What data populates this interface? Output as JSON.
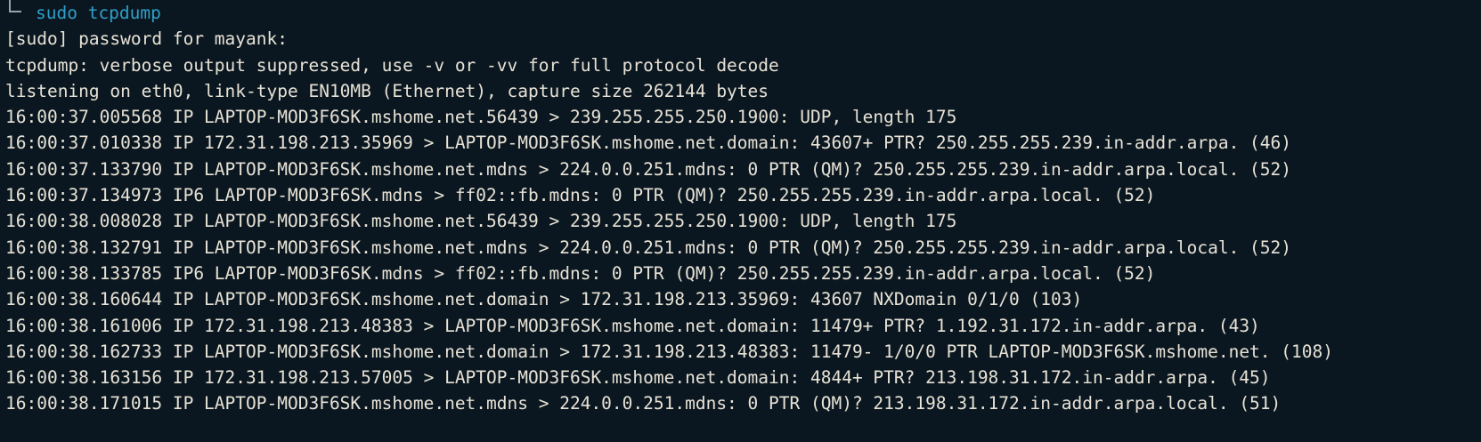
{
  "colors": {
    "background": "#0b1720",
    "text": "#e7e2d6",
    "command": "#2e9fc9",
    "prompt_branch": "#9aa3a8"
  },
  "prompt": {
    "branch_icon": "tree-branch-corner",
    "command": "sudo tcpdump"
  },
  "output": [
    "[sudo] password for mayank:",
    "tcpdump: verbose output suppressed, use -v or -vv for full protocol decode",
    "listening on eth0, link-type EN10MB (Ethernet), capture size 262144 bytes",
    "16:00:37.005568 IP LAPTOP-MOD3F6SK.mshome.net.56439 > 239.255.255.250.1900: UDP, length 175",
    "16:00:37.010338 IP 172.31.198.213.35969 > LAPTOP-MOD3F6SK.mshome.net.domain: 43607+ PTR? 250.255.255.239.in-addr.arpa. (46)",
    "16:00:37.133790 IP LAPTOP-MOD3F6SK.mshome.net.mdns > 224.0.0.251.mdns: 0 PTR (QM)? 250.255.255.239.in-addr.arpa.local. (52)",
    "16:00:37.134973 IP6 LAPTOP-MOD3F6SK.mdns > ff02::fb.mdns: 0 PTR (QM)? 250.255.255.239.in-addr.arpa.local. (52)",
    "16:00:38.008028 IP LAPTOP-MOD3F6SK.mshome.net.56439 > 239.255.255.250.1900: UDP, length 175",
    "16:00:38.132791 IP LAPTOP-MOD3F6SK.mshome.net.mdns > 224.0.0.251.mdns: 0 PTR (QM)? 250.255.255.239.in-addr.arpa.local. (52)",
    "16:00:38.133785 IP6 LAPTOP-MOD3F6SK.mdns > ff02::fb.mdns: 0 PTR (QM)? 250.255.255.239.in-addr.arpa.local. (52)",
    "16:00:38.160644 IP LAPTOP-MOD3F6SK.mshome.net.domain > 172.31.198.213.35969: 43607 NXDomain 0/1/0 (103)",
    "16:00:38.161006 IP 172.31.198.213.48383 > LAPTOP-MOD3F6SK.mshome.net.domain: 11479+ PTR? 1.192.31.172.in-addr.arpa. (43)",
    "16:00:38.162733 IP LAPTOP-MOD3F6SK.mshome.net.domain > 172.31.198.213.48383: 11479- 1/0/0 PTR LAPTOP-MOD3F6SK.mshome.net. (108)",
    "16:00:38.163156 IP 172.31.198.213.57005 > LAPTOP-MOD3F6SK.mshome.net.domain: 4844+ PTR? 213.198.31.172.in-addr.arpa. (45)",
    "16:00:38.171015 IP LAPTOP-MOD3F6SK.mshome.net.mdns > 224.0.0.251.mdns: 0 PTR (QM)? 213.198.31.172.in-addr.arpa.local. (51)"
  ]
}
